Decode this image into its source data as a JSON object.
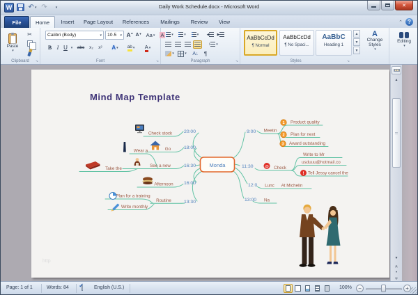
{
  "window": {
    "title": "Daily Work Schedule.docx  -  Microsoft Word"
  },
  "tabs": {
    "file": "File",
    "items": [
      "Home",
      "Insert",
      "Page Layout",
      "References",
      "Mailings",
      "Review",
      "View"
    ],
    "active": "Home"
  },
  "ribbon": {
    "clipboard": {
      "group": "Clipboard",
      "paste": "Paste"
    },
    "font": {
      "group": "Font",
      "family": "Calibri (Body)",
      "size": "10.5",
      "bold": "B",
      "italic": "I",
      "underline": "U",
      "strikethrough": "abc",
      "subscript": "x₂",
      "superscript": "x²",
      "grow": "A",
      "shrink": "A",
      "change_case": "Aa",
      "clear": "A",
      "text_effects": "A",
      "highlight": "ab",
      "font_color": "A"
    },
    "paragraph": {
      "group": "Paragraph",
      "pilcrow": "¶",
      "sort": "A↓"
    },
    "styles": {
      "group": "Styles",
      "gallery": [
        {
          "preview": "AaBbCcDd",
          "name": "¶ Normal"
        },
        {
          "preview": "AaBbCcDd",
          "name": "¶ No Spaci..."
        },
        {
          "preview": "AaBbC",
          "name": "Heading 1"
        }
      ],
      "change_styles_icon": "A",
      "change_styles": "Change Styles"
    },
    "editing": {
      "label": "Editing"
    }
  },
  "document": {
    "heading": "Mind Map Template",
    "watermark": "http"
  },
  "mindmap": {
    "center": "Monda",
    "left": [
      {
        "time": "20:00",
        "label": "Check stock",
        "icon": "monitor-icon"
      },
      {
        "time": "18:00",
        "label": "Go",
        "icon": "house-icon"
      },
      {
        "time": "16:30",
        "label": "See a new",
        "icon": "person-icon",
        "children": [
          {
            "label": "Wear a",
            "icon": "bottle-icon"
          },
          {
            "label": "Take the",
            "icon": "book-icon"
          }
        ]
      },
      {
        "time": "16:00",
        "label": "Afternoon",
        "icon": "burger-icon"
      },
      {
        "time": "13:30",
        "label": "Routine",
        "children": [
          {
            "label": "Plan for a training",
            "icon": "pie-chart-icon"
          },
          {
            "label": "Write monthly",
            "icon": "pencil-icon"
          }
        ]
      }
    ],
    "right": [
      {
        "time": "9:00",
        "label": "Meetin",
        "children": [
          {
            "label": "Product quality",
            "badge": "1"
          },
          {
            "label": "Plan for next",
            "badge": "2"
          },
          {
            "label": "Award outstanding",
            "badge": "3"
          }
        ]
      },
      {
        "time": "11:30",
        "label": "Check",
        "icon": "at-icon",
        "at_glyph": "@",
        "excl_glyph": "!",
        "children": [
          {
            "label": "Write to Mr"
          },
          {
            "label": "usduuu@hotmail.co"
          },
          {
            "label": "Tell Jessy cancel the",
            "icon": "exclamation-icon"
          }
        ]
      },
      {
        "time": "12:0",
        "label": "Lunc",
        "children": [
          {
            "label": "At Michelin"
          }
        ]
      },
      {
        "time": "13:00",
        "label": "Na"
      }
    ],
    "colors": {
      "branch": "#62c3a5",
      "time": "#4f81bd",
      "label": "#9b5a45",
      "center_border": "#e2662b",
      "heading": "#3e3377"
    }
  },
  "status": {
    "page": "Page: 1 of 1",
    "words": "Words: 84",
    "language": "English (U.S.)",
    "zoom": "100%"
  }
}
